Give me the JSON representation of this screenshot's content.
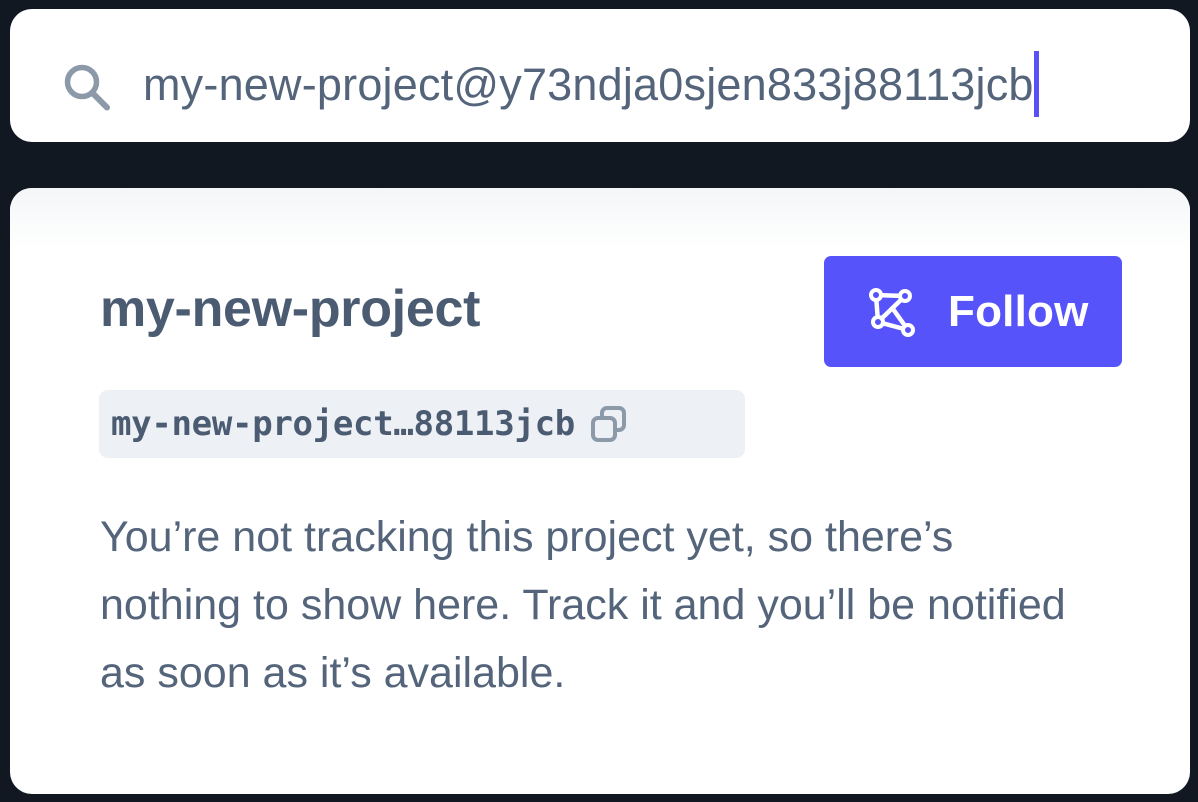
{
  "search": {
    "value": "my-new-project@y73ndja0sjen833j88113jcb",
    "icon": "search-icon"
  },
  "project": {
    "title": "my-new-project",
    "id_display": "my-new-project…88113jcb",
    "copy_icon": "copy-icon"
  },
  "follow_button": {
    "label": "Follow",
    "icon": "graph-nodes-icon"
  },
  "message": "You’re not tracking this project yet, so there’s nothing to show here. Track it and you’ll be notified as soon as it’s available.",
  "colors": {
    "background": "#111821",
    "accent": "#5753fb",
    "caret": "#5851f7",
    "text": "#4b5b72",
    "chip": "#edf0f4"
  }
}
